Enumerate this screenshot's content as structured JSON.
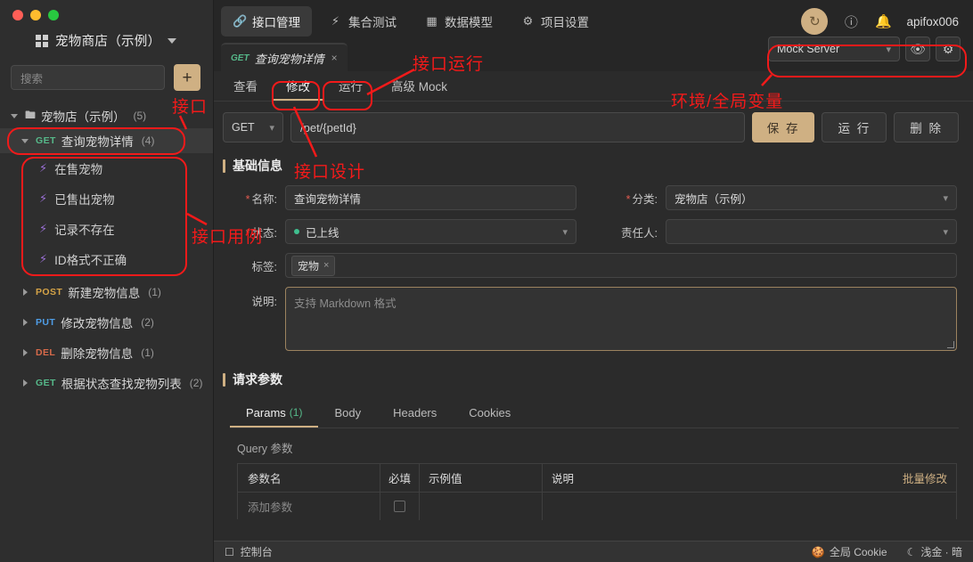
{
  "window": {
    "traffic_lights": [
      "close",
      "minimize",
      "maximize"
    ]
  },
  "sidebar": {
    "project_name": "宠物商店（示例）",
    "search_placeholder": "搜索",
    "add_button_label": "+",
    "folder": {
      "label": "宠物店（示例）",
      "count": "(5)"
    },
    "api_groups": [
      {
        "method": "GET",
        "label": "查询宠物详情",
        "count": "(4)",
        "expanded": true,
        "active": true
      },
      {
        "method": "POST",
        "label": "新建宠物信息",
        "count": "(1)",
        "expanded": false,
        "active": false
      },
      {
        "method": "PUT",
        "label": "修改宠物信息",
        "count": "(2)",
        "expanded": false,
        "active": false
      },
      {
        "method": "DEL",
        "label": "删除宠物信息",
        "count": "(1)",
        "expanded": false,
        "active": false
      },
      {
        "method": "GET",
        "label": "根据状态查找宠物列表",
        "count": "(2)",
        "expanded": false,
        "active": false
      }
    ],
    "cases": [
      {
        "label": "在售宠物"
      },
      {
        "label": "已售出宠物"
      },
      {
        "label": "记录不存在"
      },
      {
        "label": "ID格式不正确"
      }
    ]
  },
  "topbar": {
    "nav": [
      {
        "label": "接口管理",
        "icon": "link-icon",
        "active": true
      },
      {
        "label": "集合测试",
        "icon": "bolt-icon",
        "active": false
      },
      {
        "label": "数据模型",
        "icon": "model-icon",
        "active": false
      },
      {
        "label": "项目设置",
        "icon": "gear-icon",
        "active": false
      }
    ],
    "sync_icon": "sync-icon",
    "help_icon": "help-icon",
    "bell_icon": "bell-icon",
    "username": "apifox006"
  },
  "doc_tab": {
    "method": "GET",
    "title": "查询宠物详情",
    "close": "×"
  },
  "subtabs": [
    {
      "label": "查看",
      "active": false
    },
    {
      "label": "修改",
      "active": true
    },
    {
      "label": "运行",
      "active": false
    },
    {
      "label": "高级 Mock",
      "active": false
    }
  ],
  "env": {
    "selected": "Mock Server",
    "eye_icon": "eye-icon",
    "gear_icon": "gear-icon"
  },
  "url_row": {
    "method": "GET",
    "path": "/pet/{petId}",
    "save_label": "保 存",
    "run_label": "运 行",
    "delete_label": "删 除"
  },
  "basic_info": {
    "section_title": "基础信息",
    "name_label": "名称:",
    "name_value": "查询宠物详情",
    "category_label": "分类:",
    "category_value": "宠物店（示例）",
    "status_label": "状态:",
    "status_value": "已上线",
    "status_color": "#3fbf8f",
    "owner_label": "责任人:",
    "owner_value": "",
    "tags_label": "标签:",
    "tags": [
      {
        "label": "宠物",
        "remove": "×"
      }
    ],
    "desc_label": "说明:",
    "desc_placeholder": "支持 Markdown 格式"
  },
  "request_params": {
    "section_title": "请求参数",
    "tabs": [
      {
        "label": "Params",
        "count": "(1)",
        "active": true
      },
      {
        "label": "Body",
        "count": "",
        "active": false
      },
      {
        "label": "Headers",
        "count": "",
        "active": false
      },
      {
        "label": "Cookies",
        "count": "",
        "active": false
      }
    ],
    "query_label": "Query 参数",
    "columns": [
      "参数名",
      "必填",
      "示例值",
      "说明"
    ],
    "batch_edit": "批量修改",
    "rows": [
      {
        "name": "添加参数",
        "required": false,
        "example": "",
        "desc": ""
      }
    ]
  },
  "statusbar": {
    "console_label": "控制台",
    "console_icon": "terminal-icon",
    "cookie_label": "全局 Cookie",
    "cookie_icon": "cookie-icon",
    "theme_label": "浅金 · 暗",
    "theme_icon": "moon-icon"
  },
  "annotations": [
    {
      "id": "anno-api",
      "text": "接口"
    },
    {
      "id": "anno-case",
      "text": "接口用例"
    },
    {
      "id": "anno-run",
      "text": "接口运行"
    },
    {
      "id": "anno-design",
      "text": "接口设计"
    },
    {
      "id": "anno-env",
      "text": "环境/全局变量"
    }
  ],
  "colors": {
    "accent": "#cfb083",
    "annotation": "#f21a1a",
    "get": "#56b98a",
    "post": "#d6a447",
    "put": "#4f9ee8",
    "del": "#d86a4a",
    "case": "#9a6fd4"
  }
}
